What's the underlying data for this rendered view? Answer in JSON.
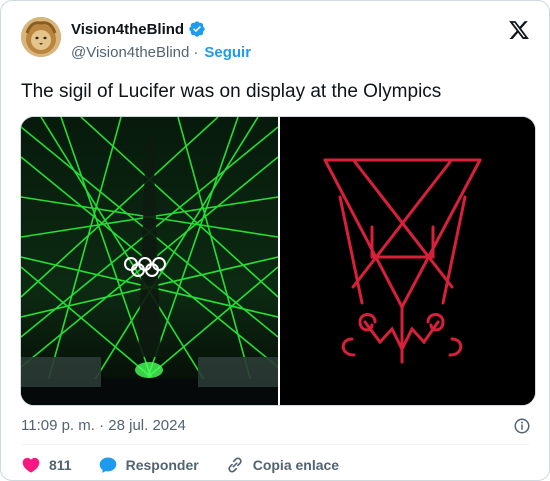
{
  "author": {
    "display_name": "Vision4theBlind",
    "handle": "@Vision4theBlind",
    "separator": "·",
    "follow_label": "Seguir",
    "verified": true,
    "verified_color": "#1d9bf0"
  },
  "tweet": {
    "text": "The sigil of Lucifer was on display at the Olympics",
    "timestamp": "11:09 p. m. · 28 jul. 2024"
  },
  "media": {
    "left_image": "laser-light-show-with-olympic-rings",
    "right_image": "red-sigil-on-black"
  },
  "actions": {
    "like_count": "811",
    "reply_label": "Responder",
    "copy_link_label": "Copia enlace"
  },
  "colors": {
    "accent": "#1d9bf0",
    "like": "#f91880",
    "laser": "#2aff3a",
    "sigil": "#d9203a"
  }
}
